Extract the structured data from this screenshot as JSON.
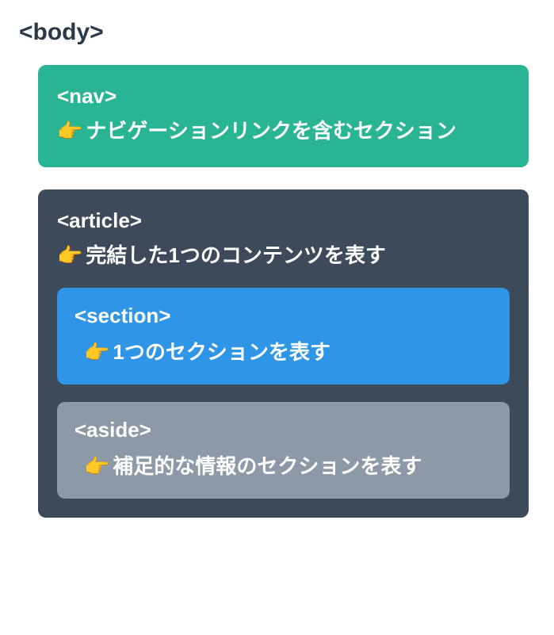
{
  "body": {
    "label": "<body>"
  },
  "nav": {
    "title": "<nav>",
    "emoji": "👉",
    "description": "ナビゲーションリンクを含むセクション"
  },
  "article": {
    "title": "<article>",
    "emoji": "👉",
    "description": "完結した1つのコンテンツを表す"
  },
  "section": {
    "title": "<section>",
    "emoji": "👉",
    "description": "1つのセクションを表す"
  },
  "aside": {
    "title": "<aside>",
    "emoji": "👉",
    "description": "補足的な情報のセクションを表す"
  }
}
